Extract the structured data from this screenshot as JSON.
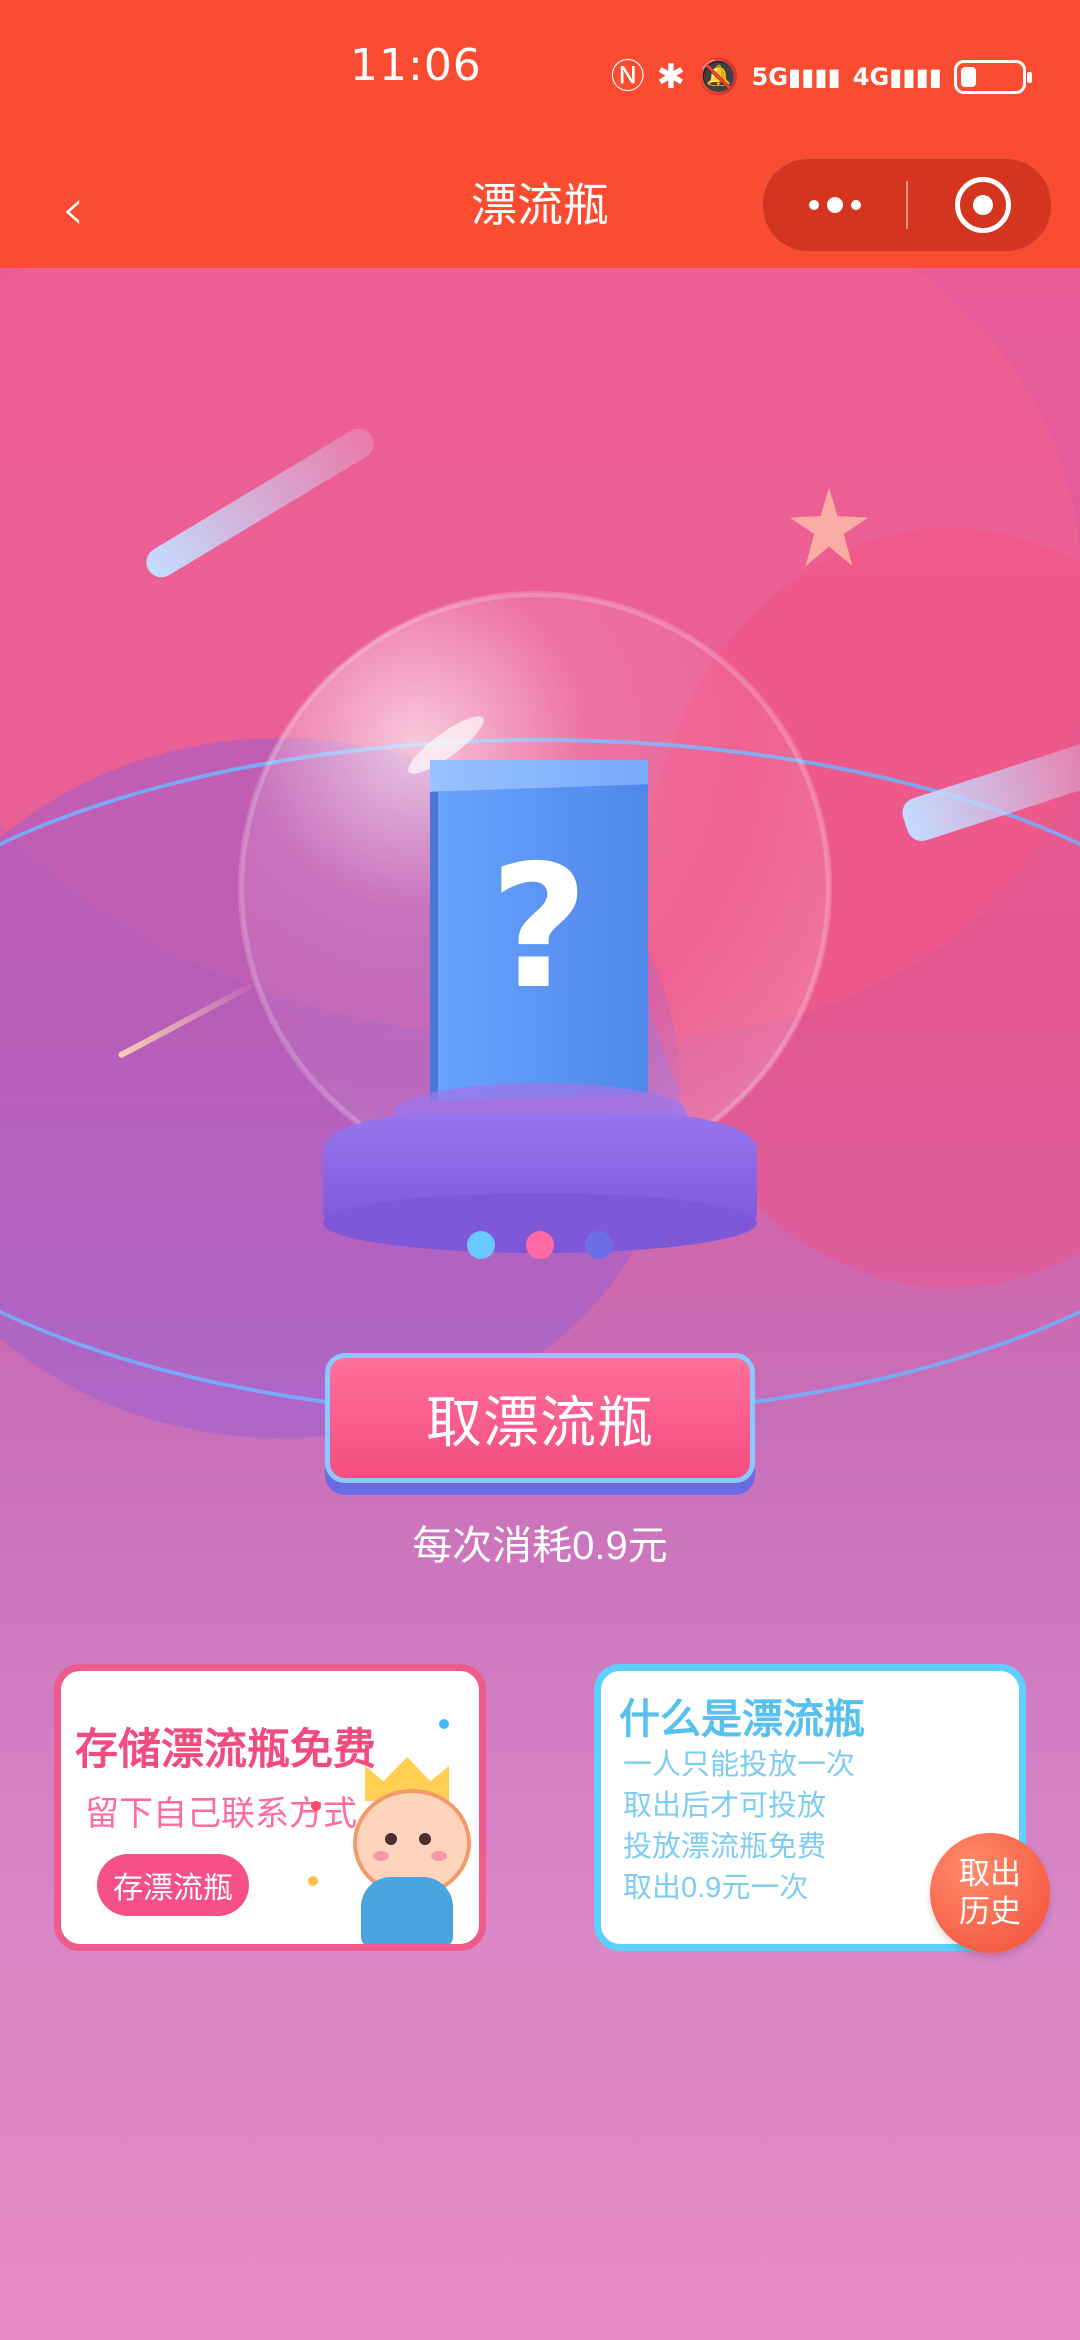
{
  "status_bar": {
    "time": "11:06",
    "icons": [
      "nfc-icon",
      "bluetooth-icon",
      "mute-icon",
      "5g-signal-icon",
      "4g-signal-icon",
      "battery-icon"
    ],
    "battery_level": 0.25
  },
  "nav": {
    "title": "漂流瓶",
    "back_icon": "back-icon",
    "more_icon": "more-icon",
    "close_icon": "target-icon"
  },
  "main": {
    "take_button_label": "取漂流瓶",
    "cost_text": "每次消耗0.9元",
    "left_card": {
      "title": "存储漂流瓶免费",
      "subtitle": "留下自己联系方式",
      "button_label": "存漂流瓶"
    },
    "right_card": {
      "title": "什么是漂流瓶",
      "lines": [
        "一人只能投放一次",
        "取出后才可投放",
        "投放漂流瓶免费",
        "取出0.9元一次"
      ]
    },
    "history_button_lines": [
      "取出",
      "历史"
    ]
  },
  "colors": {
    "primary": "#fb4b30",
    "pink": "#f24b7f",
    "blue": "#5ed0ff"
  }
}
